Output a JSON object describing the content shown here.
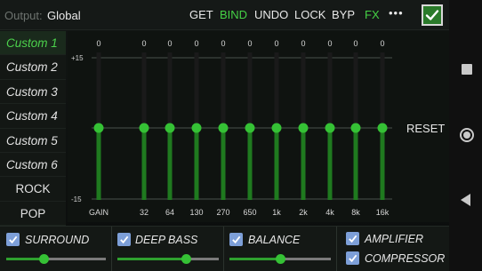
{
  "topbar": {
    "output_label": "Output:",
    "output_value": "Global",
    "buttons": [
      {
        "label": "GET",
        "active": false
      },
      {
        "label": "BIND",
        "active": true
      },
      {
        "label": "UNDO",
        "active": false
      },
      {
        "label": "LOCK",
        "active": false
      },
      {
        "label": "BYP",
        "active": false
      },
      {
        "label": "FX",
        "active": true
      }
    ],
    "more_label": "•••",
    "confirm_icon": "checkmark-icon"
  },
  "presets": [
    "Custom 1",
    "Custom 2",
    "Custom 3",
    "Custom 4",
    "Custom 5",
    "Custom 6",
    "ROCK",
    "POP"
  ],
  "active_preset": "Custom 1",
  "equalizer": {
    "scale_top": "+15",
    "scale_bottom": "-15",
    "reset_label": "RESET",
    "bands": [
      {
        "label": "GAIN",
        "value": "0",
        "level": 0
      },
      {
        "label": "32",
        "value": "0",
        "level": 0
      },
      {
        "label": "64",
        "value": "0",
        "level": 0
      },
      {
        "label": "130",
        "value": "0",
        "level": 0
      },
      {
        "label": "270",
        "value": "0",
        "level": 0
      },
      {
        "label": "650",
        "value": "0",
        "level": 0
      },
      {
        "label": "1k",
        "value": "0",
        "level": 0
      },
      {
        "label": "2k",
        "value": "0",
        "level": 0
      },
      {
        "label": "4k",
        "value": "0",
        "level": 0
      },
      {
        "label": "8k",
        "value": "0",
        "level": 0
      },
      {
        "label": "16k",
        "value": "0",
        "level": 0
      }
    ]
  },
  "effects": {
    "surround": {
      "label": "SURROUND",
      "checked": true,
      "level": 0.38
    },
    "deep_bass": {
      "label": "DEEP BASS",
      "checked": true,
      "level": 0.68
    },
    "balance": {
      "label": "BALANCE",
      "checked": true,
      "level": 0.5
    },
    "amplifier": {
      "label": "AMPLIFIER",
      "checked": true
    },
    "compressor": {
      "label": "COMPRESSOR",
      "checked": true
    }
  },
  "colors": {
    "accent": "#45d145",
    "checkbox": "#7d9fd8",
    "slider_fill": "#2ea02e"
  }
}
